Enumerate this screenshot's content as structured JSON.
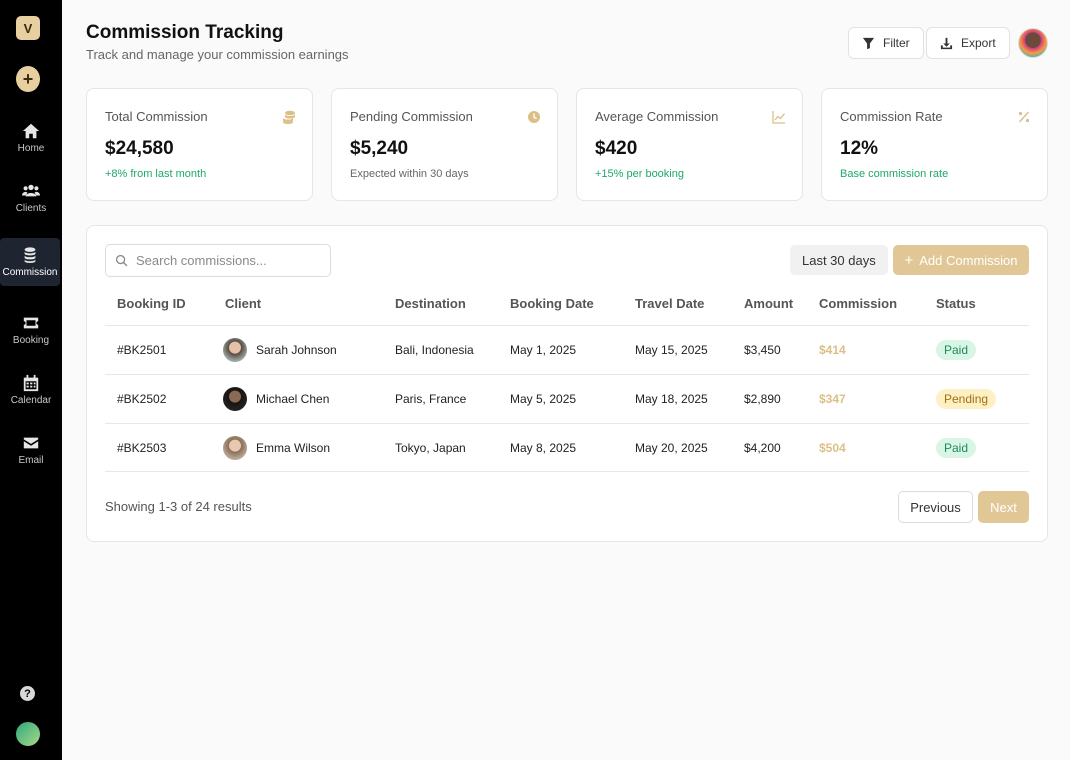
{
  "sidebar": {
    "logo_letter": "V",
    "add_symbol": "+",
    "items": [
      {
        "label": "Home",
        "icon": "home-icon"
      },
      {
        "label": "Clients",
        "icon": "users-icon"
      },
      {
        "label": "Commission",
        "icon": "coins-icon",
        "active": true
      },
      {
        "label": "Booking",
        "icon": "ticket-icon"
      },
      {
        "label": "Calendar",
        "icon": "calendar-icon"
      },
      {
        "label": "Email",
        "icon": "envelope-icon"
      }
    ],
    "help_symbol": "?"
  },
  "header": {
    "title": "Commission Tracking",
    "subtitle": "Track and manage your commission earnings",
    "filter_label": "Filter",
    "export_label": "Export"
  },
  "stats": [
    {
      "label": "Total Commission",
      "value": "$24,580",
      "note": "+8% from last month",
      "icon": "coins-icon"
    },
    {
      "label": "Pending Commission",
      "value": "$5,240",
      "note": "Expected within 30 days",
      "icon": "clock-icon"
    },
    {
      "label": "Average Commission",
      "value": "$420",
      "note": "+15% per booking",
      "icon": "chart-line-icon"
    },
    {
      "label": "Commission Rate",
      "value": "12%",
      "note": "Base commission rate",
      "icon": "percent-icon"
    }
  ],
  "table": {
    "search_placeholder": "Search commissions...",
    "range_label": "Last 30 days",
    "add_label": "Add Commission",
    "add_symbol": "+",
    "columns": [
      "Booking ID",
      "Client",
      "Destination",
      "Booking Date",
      "Travel Date",
      "Amount",
      "Commission",
      "Status"
    ],
    "rows": [
      {
        "id": "#BK2501",
        "client": "Sarah Johnson",
        "destination": "Bali, Indonesia",
        "booking_date": "May 1, 2025",
        "travel_date": "May 15, 2025",
        "amount": "$3,450",
        "commission": "$414",
        "status": "Paid"
      },
      {
        "id": "#BK2502",
        "client": "Michael Chen",
        "destination": "Paris, France",
        "booking_date": "May 5, 2025",
        "travel_date": "May 18, 2025",
        "amount": "$2,890",
        "commission": "$347",
        "status": "Pending"
      },
      {
        "id": "#BK2503",
        "client": "Emma Wilson",
        "destination": "Tokyo, Japan",
        "booking_date": "May 8, 2025",
        "travel_date": "May 20, 2025",
        "amount": "$4,200",
        "commission": "$504",
        "status": "Paid"
      }
    ],
    "results_text": "Showing 1-3 of 24 results",
    "prev_label": "Previous",
    "next_label": "Next"
  },
  "colors": {
    "accent": "#e2c796",
    "accent_text": "#dcbf86",
    "positive": "#1fa86b",
    "sidebar_bg": "#000000",
    "paid_bg": "#d9f5e6",
    "pending_bg": "#fdf0c4"
  }
}
